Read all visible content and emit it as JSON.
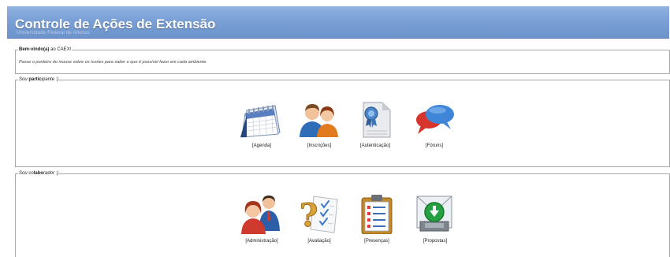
{
  "header": {
    "title": "Controle de Ações de Extensão",
    "subtitle": "Universidade Federal de Alfenas"
  },
  "welcome": {
    "legend_bold": "Bem-vindo(a)",
    "legend_rest": " ao CAEX!",
    "hint": "Passe o ponteiro do mouse sobre os ícones para saber o que é possível fazer em cada ambiente."
  },
  "participante": {
    "legend_pre": "Sou ",
    "legend_bold": "partic",
    "legend_post": "ipante :)",
    "items": [
      {
        "label": "[Agenda]",
        "icon": "calendar-icon"
      },
      {
        "label": "[Inscrições]",
        "icon": "users-icon"
      },
      {
        "label": "[Autenticação]",
        "icon": "certificate-icon"
      },
      {
        "label": "[Fóruns]",
        "icon": "chat-bubbles-icon"
      }
    ]
  },
  "colaborador": {
    "legend_pre": "Sou co",
    "legend_bold": "labo",
    "legend_post": "rador :)",
    "items": [
      {
        "label": "[Administração]",
        "icon": "admin-users-icon"
      },
      {
        "label": "[Avaliação]",
        "icon": "evaluation-icon"
      },
      {
        "label": "[Presenças]",
        "icon": "clipboard-icon"
      },
      {
        "label": "[Propostas]",
        "icon": "inbox-download-icon"
      }
    ]
  },
  "colors": {
    "header_blue": "#7aa0d6",
    "border": "#a9a9a9"
  }
}
